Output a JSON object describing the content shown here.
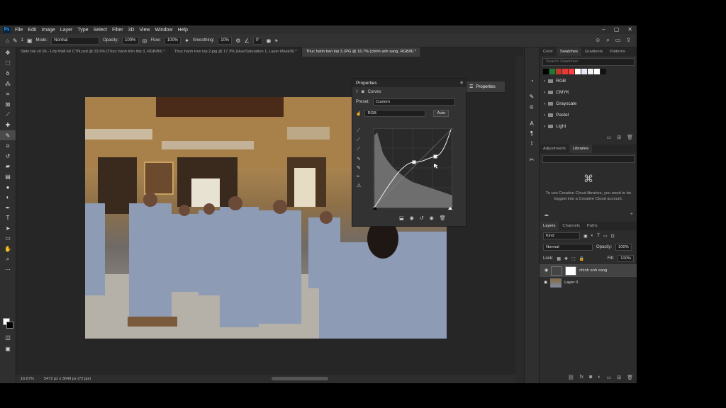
{
  "menu": [
    "File",
    "Edit",
    "Image",
    "Layer",
    "Type",
    "Select",
    "Filter",
    "3D",
    "View",
    "Window",
    "Help"
  ],
  "app_logo": "Ps",
  "options": {
    "mode_label": "Mode:",
    "mode_value": "Normal",
    "opacity_label": "Opacity:",
    "opacity_value": "100%",
    "flow_label": "Flow:",
    "flow_value": "100%",
    "smoothing_label": "Smoothing:",
    "smoothing_value": "10%",
    "angle_value": "0°",
    "brush_size": "1"
  },
  "tabs": [
    {
      "label": "Slide bài số 06 - Lớp thiết kế CTN.psd @ 33.6% (Thực hành trên lớp 3, RGB/8#) *"
    },
    {
      "label": "Thuc hanh tren lop 2.jpg @ 17.3% (Hue/Saturation 1, Layer Mask/8) *"
    },
    {
      "label": "Thuc hanh tren lop 3.JPG @ 16.7% (chinh anh sang, RGB/8) *",
      "active": true
    }
  ],
  "status": {
    "zoom": "16.67%",
    "doc_size": "5472 px x 3648 px (72 ppi)"
  },
  "properties": {
    "title": "Properties",
    "adjustment": "Curves",
    "preset_label": "Preset:",
    "preset_value": "Custom",
    "channel": "RGB",
    "auto_label": "Auto"
  },
  "collapsed_panel": {
    "label": "Properties"
  },
  "swatches_panel": {
    "tabs": [
      "Color",
      "Swatches",
      "Gradients",
      "Patterns"
    ],
    "active_tab": "Swatches",
    "search_placeholder": "Search Swatches",
    "colors": [
      "#000000",
      "#1e7a2e",
      "#c0392b",
      "#e53935",
      "#ff3d3d",
      "#ffffff",
      "#e8e8f4",
      "#f2f2f2",
      "#ffffff",
      "#111111"
    ],
    "folders": [
      "RGB",
      "CMYK",
      "Grayscale",
      "Pastel",
      "Light"
    ]
  },
  "libraries_panel": {
    "tabs": [
      "Adjustments",
      "Libraries"
    ],
    "active_tab": "Libraries",
    "message": "To use Creative Cloud libraries, you need to be logged into a Creative Cloud account."
  },
  "layers_panel": {
    "tabs": [
      "Layers",
      "Channels",
      "Paths"
    ],
    "active_tab": "Layers",
    "kind_label": "Kind",
    "blend_mode": "Normal",
    "opacity_label": "Opacity:",
    "opacity_value": "100%",
    "lock_label": "Lock:",
    "fill_label": "Fill:",
    "fill_value": "100%",
    "layers": [
      {
        "name": "chinh anh sang",
        "selected": true
      },
      {
        "name": "Layer 0",
        "selected": false
      }
    ]
  },
  "colors": {
    "accent": "#31a8ff",
    "panel": "#323232",
    "app_bg": "#2a2a2a"
  }
}
